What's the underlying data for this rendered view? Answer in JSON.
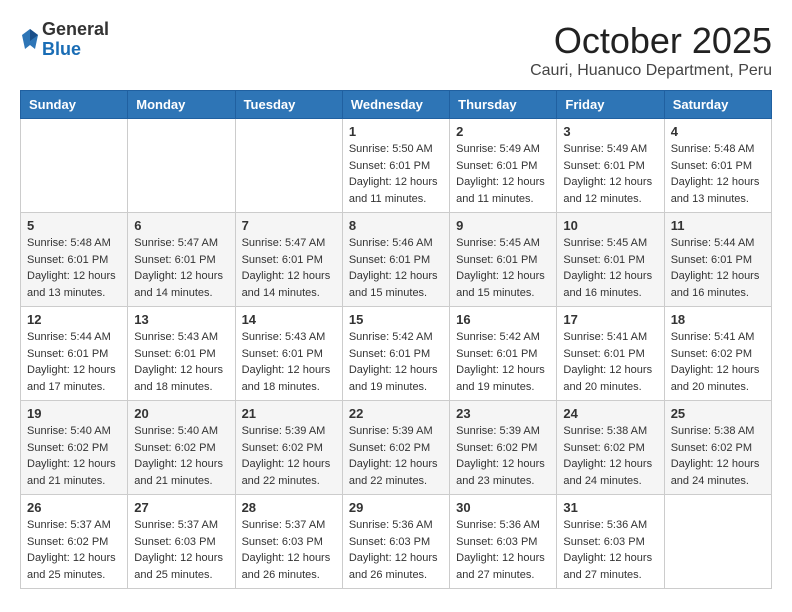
{
  "header": {
    "logo": {
      "general": "General",
      "blue": "Blue"
    },
    "title": "October 2025",
    "subtitle": "Cauri, Huanuco Department, Peru"
  },
  "calendar": {
    "headers": [
      "Sunday",
      "Monday",
      "Tuesday",
      "Wednesday",
      "Thursday",
      "Friday",
      "Saturday"
    ],
    "weeks": [
      [
        {
          "day": "",
          "info": ""
        },
        {
          "day": "",
          "info": ""
        },
        {
          "day": "",
          "info": ""
        },
        {
          "day": "1",
          "info": "Sunrise: 5:50 AM\nSunset: 6:01 PM\nDaylight: 12 hours\nand 11 minutes."
        },
        {
          "day": "2",
          "info": "Sunrise: 5:49 AM\nSunset: 6:01 PM\nDaylight: 12 hours\nand 11 minutes."
        },
        {
          "day": "3",
          "info": "Sunrise: 5:49 AM\nSunset: 6:01 PM\nDaylight: 12 hours\nand 12 minutes."
        },
        {
          "day": "4",
          "info": "Sunrise: 5:48 AM\nSunset: 6:01 PM\nDaylight: 12 hours\nand 13 minutes."
        }
      ],
      [
        {
          "day": "5",
          "info": "Sunrise: 5:48 AM\nSunset: 6:01 PM\nDaylight: 12 hours\nand 13 minutes."
        },
        {
          "day": "6",
          "info": "Sunrise: 5:47 AM\nSunset: 6:01 PM\nDaylight: 12 hours\nand 14 minutes."
        },
        {
          "day": "7",
          "info": "Sunrise: 5:47 AM\nSunset: 6:01 PM\nDaylight: 12 hours\nand 14 minutes."
        },
        {
          "day": "8",
          "info": "Sunrise: 5:46 AM\nSunset: 6:01 PM\nDaylight: 12 hours\nand 15 minutes."
        },
        {
          "day": "9",
          "info": "Sunrise: 5:45 AM\nSunset: 6:01 PM\nDaylight: 12 hours\nand 15 minutes."
        },
        {
          "day": "10",
          "info": "Sunrise: 5:45 AM\nSunset: 6:01 PM\nDaylight: 12 hours\nand 16 minutes."
        },
        {
          "day": "11",
          "info": "Sunrise: 5:44 AM\nSunset: 6:01 PM\nDaylight: 12 hours\nand 16 minutes."
        }
      ],
      [
        {
          "day": "12",
          "info": "Sunrise: 5:44 AM\nSunset: 6:01 PM\nDaylight: 12 hours\nand 17 minutes."
        },
        {
          "day": "13",
          "info": "Sunrise: 5:43 AM\nSunset: 6:01 PM\nDaylight: 12 hours\nand 18 minutes."
        },
        {
          "day": "14",
          "info": "Sunrise: 5:43 AM\nSunset: 6:01 PM\nDaylight: 12 hours\nand 18 minutes."
        },
        {
          "day": "15",
          "info": "Sunrise: 5:42 AM\nSunset: 6:01 PM\nDaylight: 12 hours\nand 19 minutes."
        },
        {
          "day": "16",
          "info": "Sunrise: 5:42 AM\nSunset: 6:01 PM\nDaylight: 12 hours\nand 19 minutes."
        },
        {
          "day": "17",
          "info": "Sunrise: 5:41 AM\nSunset: 6:01 PM\nDaylight: 12 hours\nand 20 minutes."
        },
        {
          "day": "18",
          "info": "Sunrise: 5:41 AM\nSunset: 6:02 PM\nDaylight: 12 hours\nand 20 minutes."
        }
      ],
      [
        {
          "day": "19",
          "info": "Sunrise: 5:40 AM\nSunset: 6:02 PM\nDaylight: 12 hours\nand 21 minutes."
        },
        {
          "day": "20",
          "info": "Sunrise: 5:40 AM\nSunset: 6:02 PM\nDaylight: 12 hours\nand 21 minutes."
        },
        {
          "day": "21",
          "info": "Sunrise: 5:39 AM\nSunset: 6:02 PM\nDaylight: 12 hours\nand 22 minutes."
        },
        {
          "day": "22",
          "info": "Sunrise: 5:39 AM\nSunset: 6:02 PM\nDaylight: 12 hours\nand 22 minutes."
        },
        {
          "day": "23",
          "info": "Sunrise: 5:39 AM\nSunset: 6:02 PM\nDaylight: 12 hours\nand 23 minutes."
        },
        {
          "day": "24",
          "info": "Sunrise: 5:38 AM\nSunset: 6:02 PM\nDaylight: 12 hours\nand 24 minutes."
        },
        {
          "day": "25",
          "info": "Sunrise: 5:38 AM\nSunset: 6:02 PM\nDaylight: 12 hours\nand 24 minutes."
        }
      ],
      [
        {
          "day": "26",
          "info": "Sunrise: 5:37 AM\nSunset: 6:02 PM\nDaylight: 12 hours\nand 25 minutes."
        },
        {
          "day": "27",
          "info": "Sunrise: 5:37 AM\nSunset: 6:03 PM\nDaylight: 12 hours\nand 25 minutes."
        },
        {
          "day": "28",
          "info": "Sunrise: 5:37 AM\nSunset: 6:03 PM\nDaylight: 12 hours\nand 26 minutes."
        },
        {
          "day": "29",
          "info": "Sunrise: 5:36 AM\nSunset: 6:03 PM\nDaylight: 12 hours\nand 26 minutes."
        },
        {
          "day": "30",
          "info": "Sunrise: 5:36 AM\nSunset: 6:03 PM\nDaylight: 12 hours\nand 27 minutes."
        },
        {
          "day": "31",
          "info": "Sunrise: 5:36 AM\nSunset: 6:03 PM\nDaylight: 12 hours\nand 27 minutes."
        },
        {
          "day": "",
          "info": ""
        }
      ]
    ]
  }
}
